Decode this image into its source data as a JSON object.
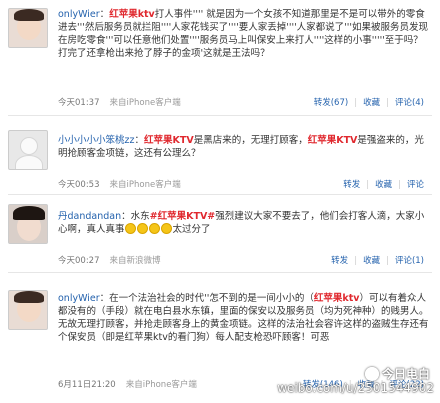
{
  "posts": [
    {
      "user": "onlyWier",
      "body_pre": "：",
      "highlight": "红苹果ktv",
      "body_post": "打人事件'''' 就是因为一个女孩不知道那里是不是可以带外的零食进去'''然后服务员就拦阻''''人家花钱买了''''要人家丢掉''''人家都说了'''如果被服务员发现在房吃零食'''可以任意他们处置''''服务员马上叫保安上来打人''''这样的小事'''''至于吗？打完了还拿枪出来抢了脖子的金项'这就是王法吗？",
      "time": "今天01:37",
      "source": "来自iPhone客户端",
      "forward": "转发(67)",
      "fav": "收藏",
      "comment": "评论(4)"
    },
    {
      "user": "小小小小小笨桃zz",
      "body_pre": "：",
      "highlight": "红苹果KTV",
      "body_mid": "是黑店来的，无理打顾客，",
      "highlight2": "红苹果KTV",
      "body_post": "是强盗来的，光明抢顾客金项链，这还有公理么？",
      "time": "今天00:53",
      "source": "来自iPhone客户端",
      "forward": "转发",
      "fav": "收藏",
      "comment": "评论"
    },
    {
      "user": "丹dandandan",
      "body_pre": "：水东",
      "highlight": "#红苹果KTV#",
      "body_post": "强烈建议大家不要去了，他们会打客人滴，大家小心啊，真人真事",
      "body_tail": "太过分了",
      "time": "今天00:27",
      "source": "来自新浪微博",
      "forward": "转发",
      "fav": "收藏",
      "comment": "评论(1)"
    },
    {
      "user": "onlyWier",
      "body_pre": "：在一个法治社会的时代''怎不到的是一间小小的（",
      "highlight": "红苹果ktv",
      "body_post": "）可以有着众人都没有的（手段）就在电白县水东镇，里面的保安以及服务员（均为死神种）的贱男人。无故无理打顾客，并抢走顾客身上的黄金项链。这样的法治社会容许这样的盗贼生存还有个保安员（即是红苹果ktv的看门狗）每人配支枪恐吓顾客！可恶",
      "time": "6月11日21:20",
      "source": "来自iPhone客户端",
      "forward": "转发(146)",
      "fav": "收藏",
      "comment": "评论(22)"
    }
  ],
  "watermark": {
    "brand": "今日电白",
    "url": "weibo.com/u/2501544902"
  },
  "colors": {
    "link": "#2462ad",
    "highlight": "#e0282e",
    "meta": "#999999"
  }
}
